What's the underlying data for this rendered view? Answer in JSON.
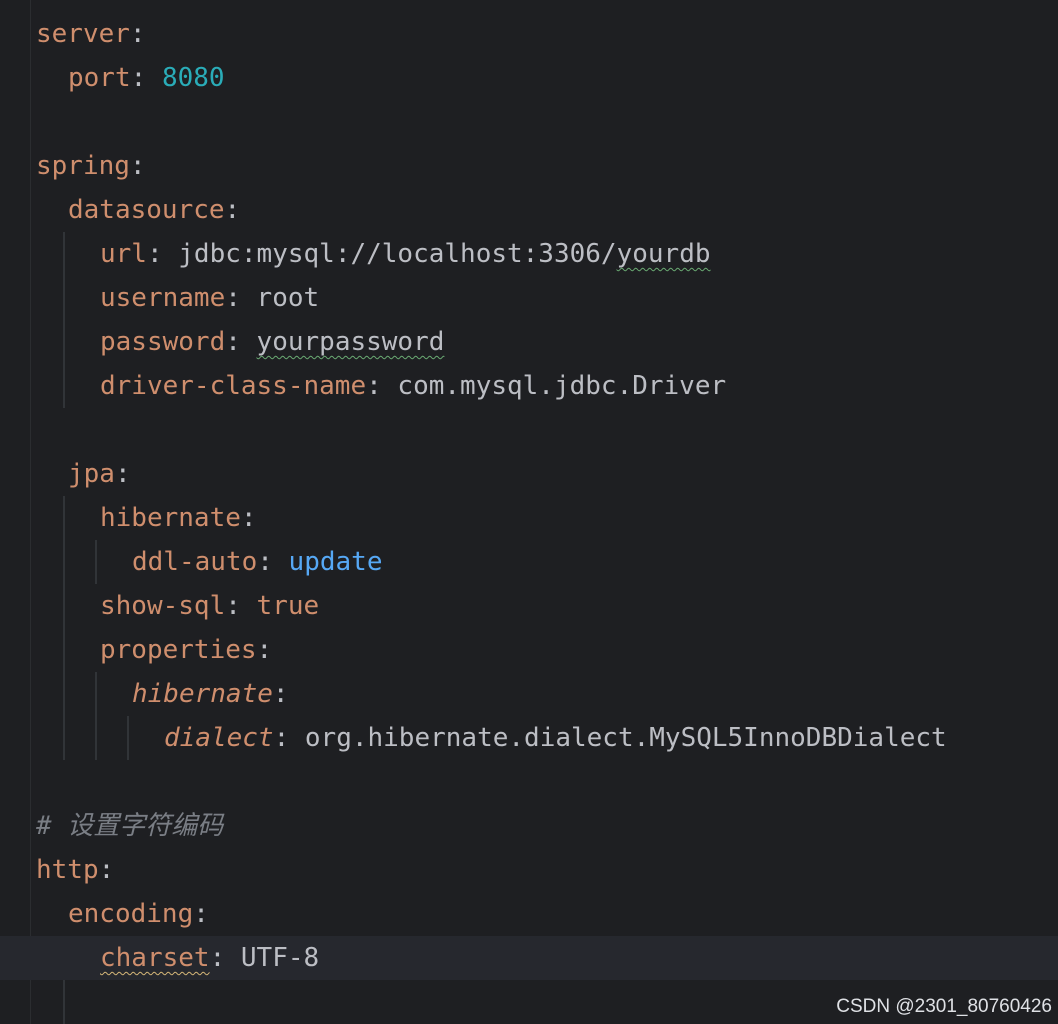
{
  "editor": {
    "lines": [
      {
        "key": "server",
        "sep": ":",
        "value": "",
        "value_class": ""
      },
      {
        "key": "port",
        "sep": ": ",
        "value": "8080",
        "value_class": "num"
      },
      {
        "key": "",
        "sep": "",
        "value": "",
        "value_class": ""
      },
      {
        "key": "spring",
        "sep": ":",
        "value": "",
        "value_class": ""
      },
      {
        "key": "datasource",
        "sep": ":",
        "value": "",
        "value_class": ""
      },
      {
        "key": "url",
        "sep": ": ",
        "value_prefix": "jdbc:mysql://localhost:3306/",
        "value": "yourdb",
        "value_class": "squiggle-green"
      },
      {
        "key": "username",
        "sep": ": ",
        "value": "root",
        "value_class": "v"
      },
      {
        "key": "password",
        "sep": ": ",
        "value": "yourpassword",
        "value_class": "squiggle-green"
      },
      {
        "key": "driver-class-name",
        "sep": ": ",
        "value": "com.mysql.jdbc.Driver",
        "value_class": "v"
      },
      {
        "key": "",
        "sep": "",
        "value": "",
        "value_class": ""
      },
      {
        "key": "jpa",
        "sep": ":",
        "value": "",
        "value_class": ""
      },
      {
        "key": "hibernate",
        "sep": ":",
        "value": "",
        "value_class": ""
      },
      {
        "key": "ddl-auto",
        "sep": ": ",
        "value": "update",
        "value_class": "kw-blue"
      },
      {
        "key": "show-sql",
        "sep": ": ",
        "value": "true",
        "value_class": "bool"
      },
      {
        "key": "properties",
        "sep": ":",
        "value": "",
        "value_class": ""
      },
      {
        "key": "hibernate",
        "sep": ":",
        "value": "",
        "value_class": "",
        "italic": true
      },
      {
        "key": "dialect",
        "sep": ": ",
        "value": "org.hibernate.dialect.MySQL5InnoDBDialect",
        "value_class": "v",
        "italic": true
      },
      {
        "key": "",
        "sep": "",
        "value": "",
        "value_class": ""
      },
      {
        "comment": "# 设置字符编码"
      },
      {
        "key": "http",
        "sep": ":",
        "value": "",
        "value_class": ""
      },
      {
        "key": "encoding",
        "sep": ":",
        "value": "",
        "value_class": ""
      },
      {
        "key": "charset",
        "sep": ": ",
        "value": "UTF-8",
        "value_class": "v",
        "key_squiggle": true
      }
    ]
  },
  "watermark": "CSDN @2301_80760426"
}
